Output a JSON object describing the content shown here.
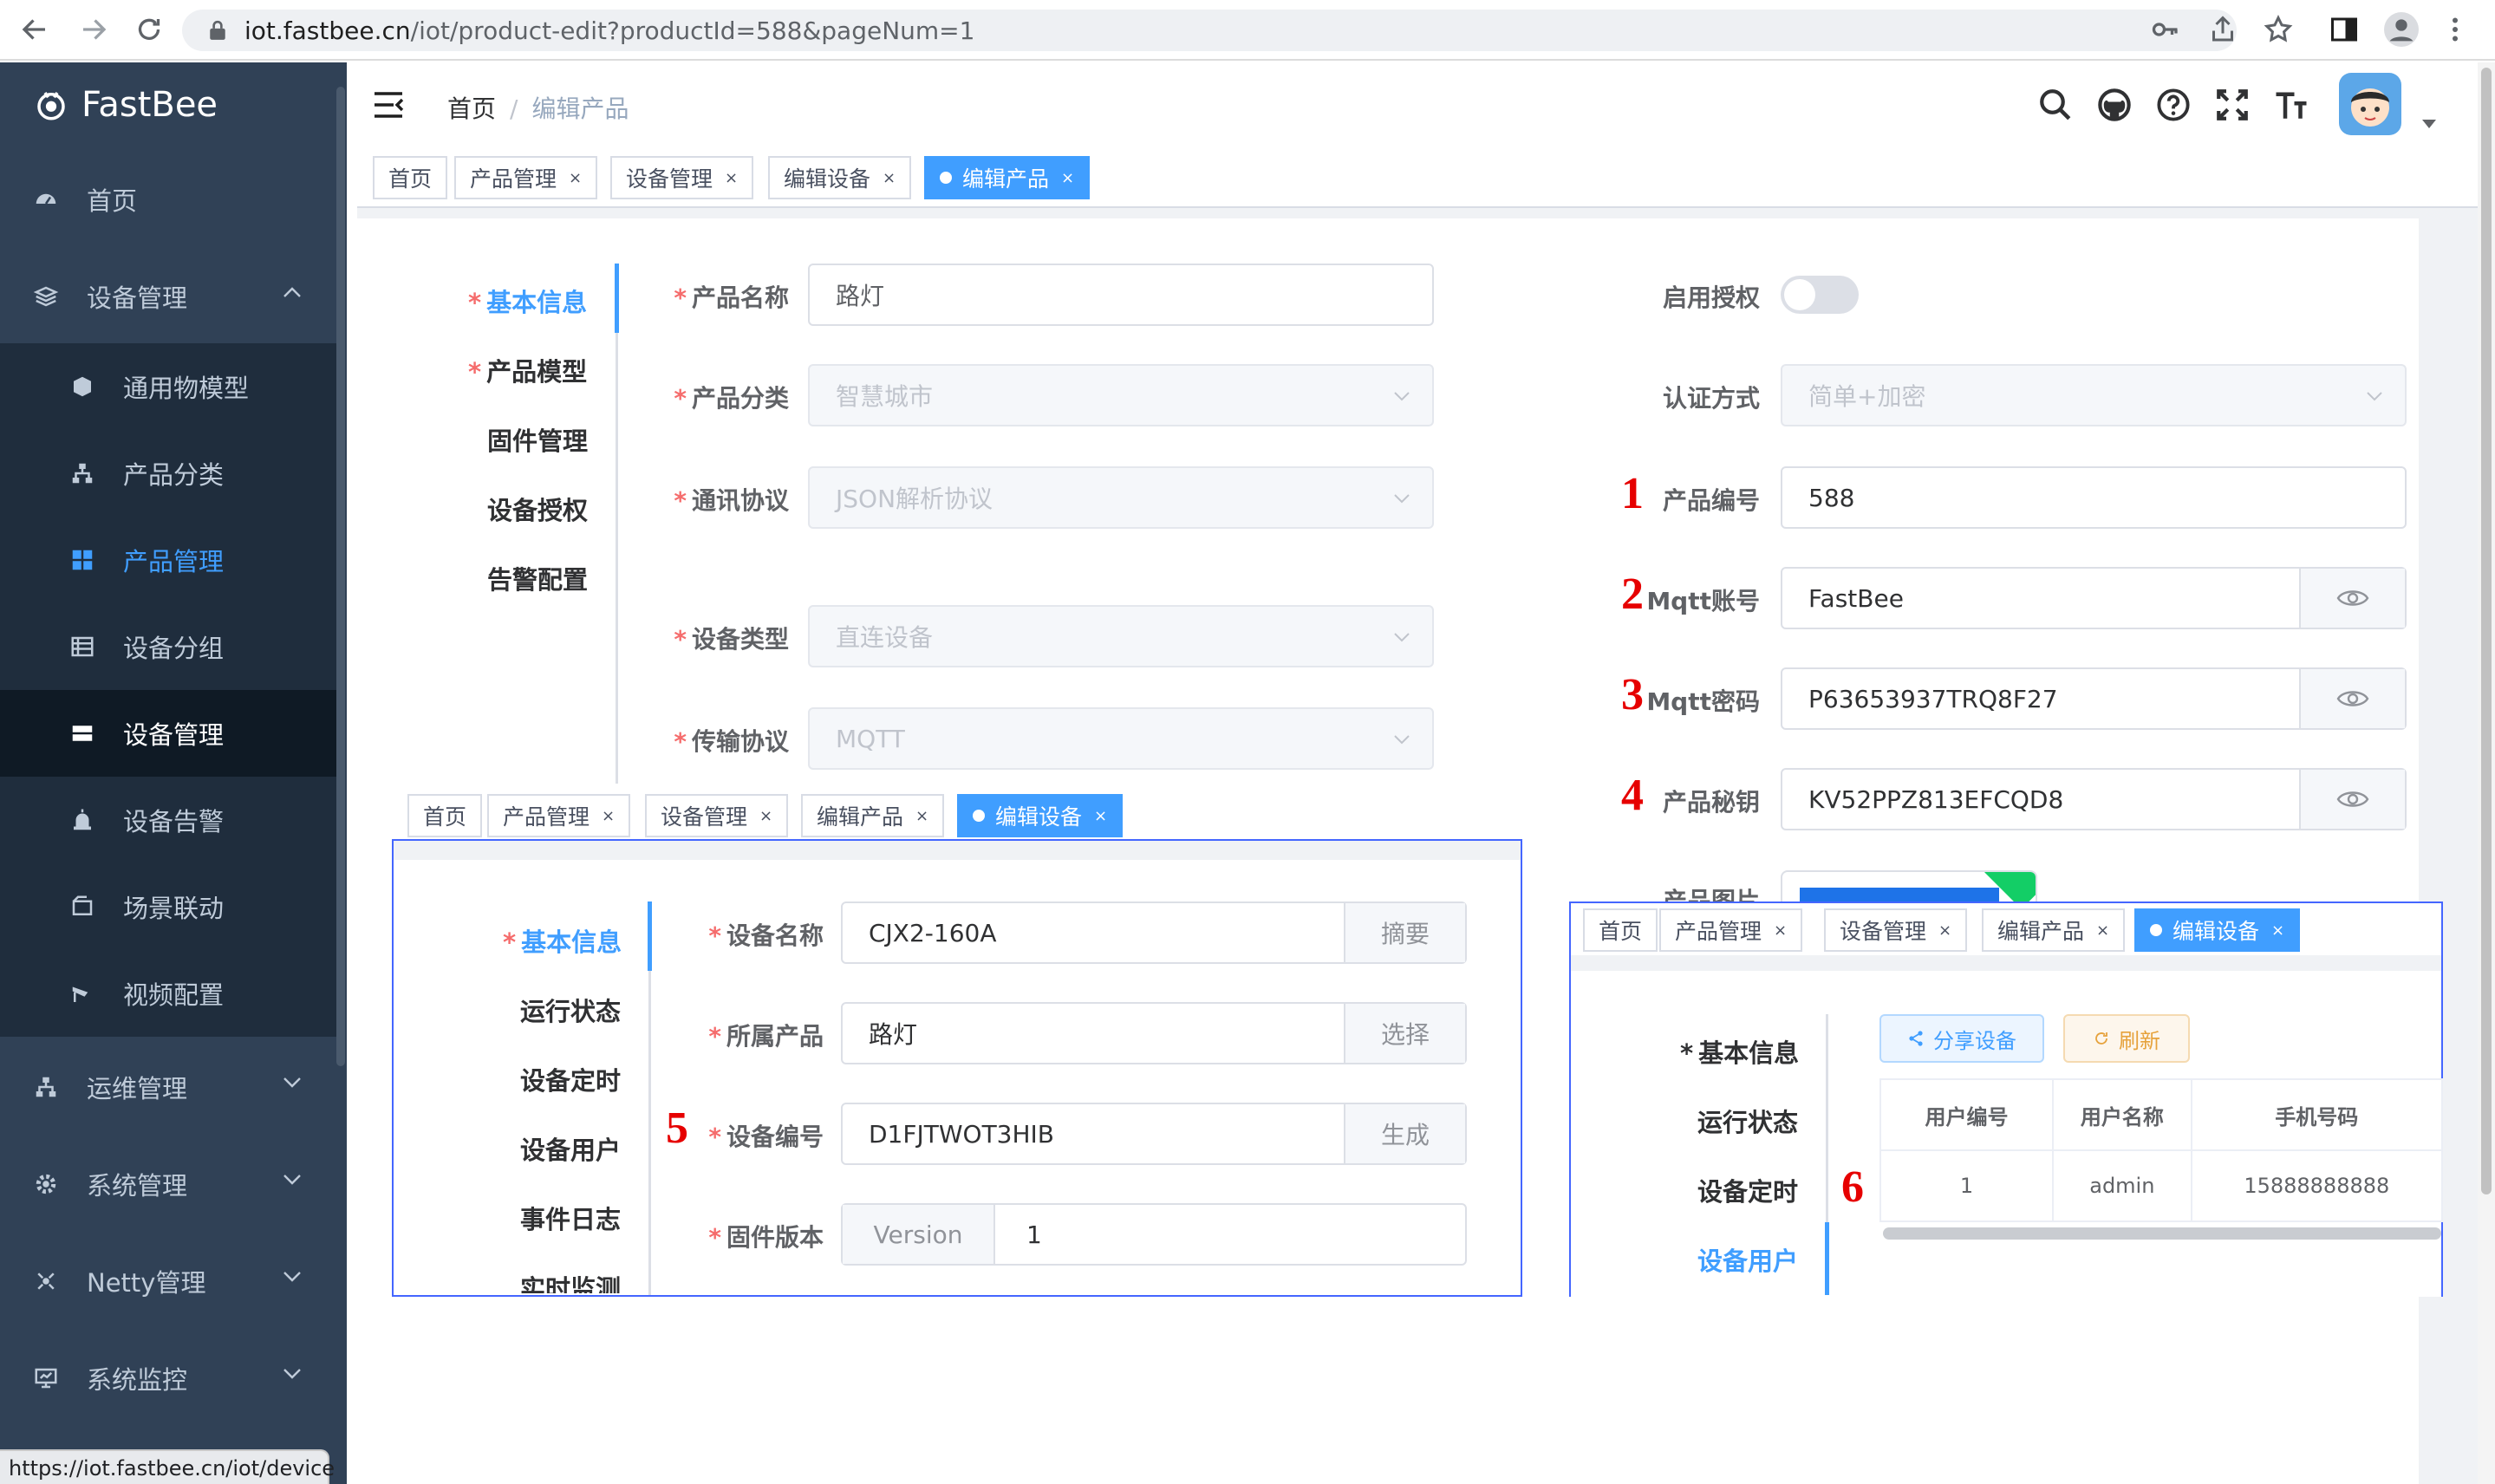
{
  "browser": {
    "url_host": "iot.fastbee.cn",
    "url_path": "/iot/product-edit?productId=588&pageNum=1",
    "status_url": "https://iot.fastbee.cn/iot/device"
  },
  "sidebar": {
    "logo": "FastBee",
    "items": [
      {
        "label": "首页",
        "icon": "dashboard-icon"
      },
      {
        "label": "设备管理",
        "icon": "layers-icon"
      },
      {
        "label": "通用物模型",
        "icon": "cube-icon"
      },
      {
        "label": "产品分类",
        "icon": "tree-icon"
      },
      {
        "label": "产品管理",
        "icon": "grid-icon"
      },
      {
        "label": "设备分组",
        "icon": "list-icon"
      },
      {
        "label": "设备管理",
        "icon": "server-icon"
      },
      {
        "label": "设备告警",
        "icon": "alarm-icon"
      },
      {
        "label": "场景联动",
        "icon": "scene-icon"
      },
      {
        "label": "视频配置",
        "icon": "camera-icon"
      },
      {
        "label": "运维管理",
        "icon": "ops-icon"
      },
      {
        "label": "系统管理",
        "icon": "gear-icon"
      },
      {
        "label": "Netty管理",
        "icon": "netty-icon"
      },
      {
        "label": "系统监控",
        "icon": "monitor-icon"
      }
    ]
  },
  "header": {
    "breadcrumb": [
      "首页",
      "编辑产品"
    ],
    "icons": [
      "search-icon",
      "github-icon",
      "help-icon",
      "fullscreen-icon",
      "font-size-icon"
    ]
  },
  "tabs_main": [
    "首页",
    "产品管理",
    "设备管理",
    "编辑设备",
    "编辑产品"
  ],
  "product_steps": [
    "基本信息",
    "产品模型",
    "固件管理",
    "设备授权",
    "告警配置"
  ],
  "product_form": {
    "name_label": "产品名称",
    "name_value": "路灯",
    "category_label": "产品分类",
    "category_value": "智慧城市",
    "protocol_label": "通讯协议",
    "protocol_value": "JSON解析协议",
    "device_type_label": "设备类型",
    "device_type_value": "直连设备",
    "transport_label": "传输协议",
    "transport_value": "MQTT",
    "auth_enable_label": "启用授权",
    "auth_mode_label": "认证方式",
    "auth_mode_value": "简单+加密",
    "product_id_label": "产品编号",
    "product_id_value": "588",
    "mqtt_account_label": "Mqtt账号",
    "mqtt_account_value": "FastBee",
    "mqtt_password_label": "Mqtt密码",
    "mqtt_password_value": "P63653937TRQ8F27",
    "product_secret_label": "产品秘钥",
    "product_secret_value": "KV52PPZ813EFCQD8",
    "image_label": "产品图片"
  },
  "annotations": [
    "1",
    "2",
    "3",
    "4",
    "5",
    "6"
  ],
  "tabs_device": [
    "首页",
    "产品管理",
    "设备管理",
    "编辑产品",
    "编辑设备"
  ],
  "device_steps": [
    "基本信息",
    "运行状态",
    "设备定时",
    "设备用户",
    "事件日志",
    "实时监测"
  ],
  "device_form": {
    "name_label": "设备名称",
    "name_value": "CJX2-160A",
    "name_btn": "摘要",
    "product_label": "所属产品",
    "product_value": "路灯",
    "product_btn": "选择",
    "serial_label": "设备编号",
    "serial_value": "D1FJTWOT3HIB",
    "serial_btn": "生成",
    "firmware_label": "固件版本",
    "firmware_prefix": "Version",
    "firmware_value": "1"
  },
  "tabs_user": [
    "首页",
    "产品管理",
    "设备管理",
    "编辑产品",
    "编辑设备"
  ],
  "user_steps": [
    "基本信息",
    "运行状态",
    "设备定时",
    "设备用户"
  ],
  "user_panel": {
    "share_btn": "分享设备",
    "refresh_btn": "刷新",
    "columns": [
      "用户编号",
      "用户名称",
      "手机号码"
    ],
    "rows": [
      [
        "1",
        "admin",
        "15888888888"
      ]
    ]
  },
  "colors": {
    "sidebar_bg": "#304156",
    "primary": "#409eff",
    "required": "#f56c6c",
    "annotation": "#e60000",
    "overlay_border": "#4466ff"
  }
}
